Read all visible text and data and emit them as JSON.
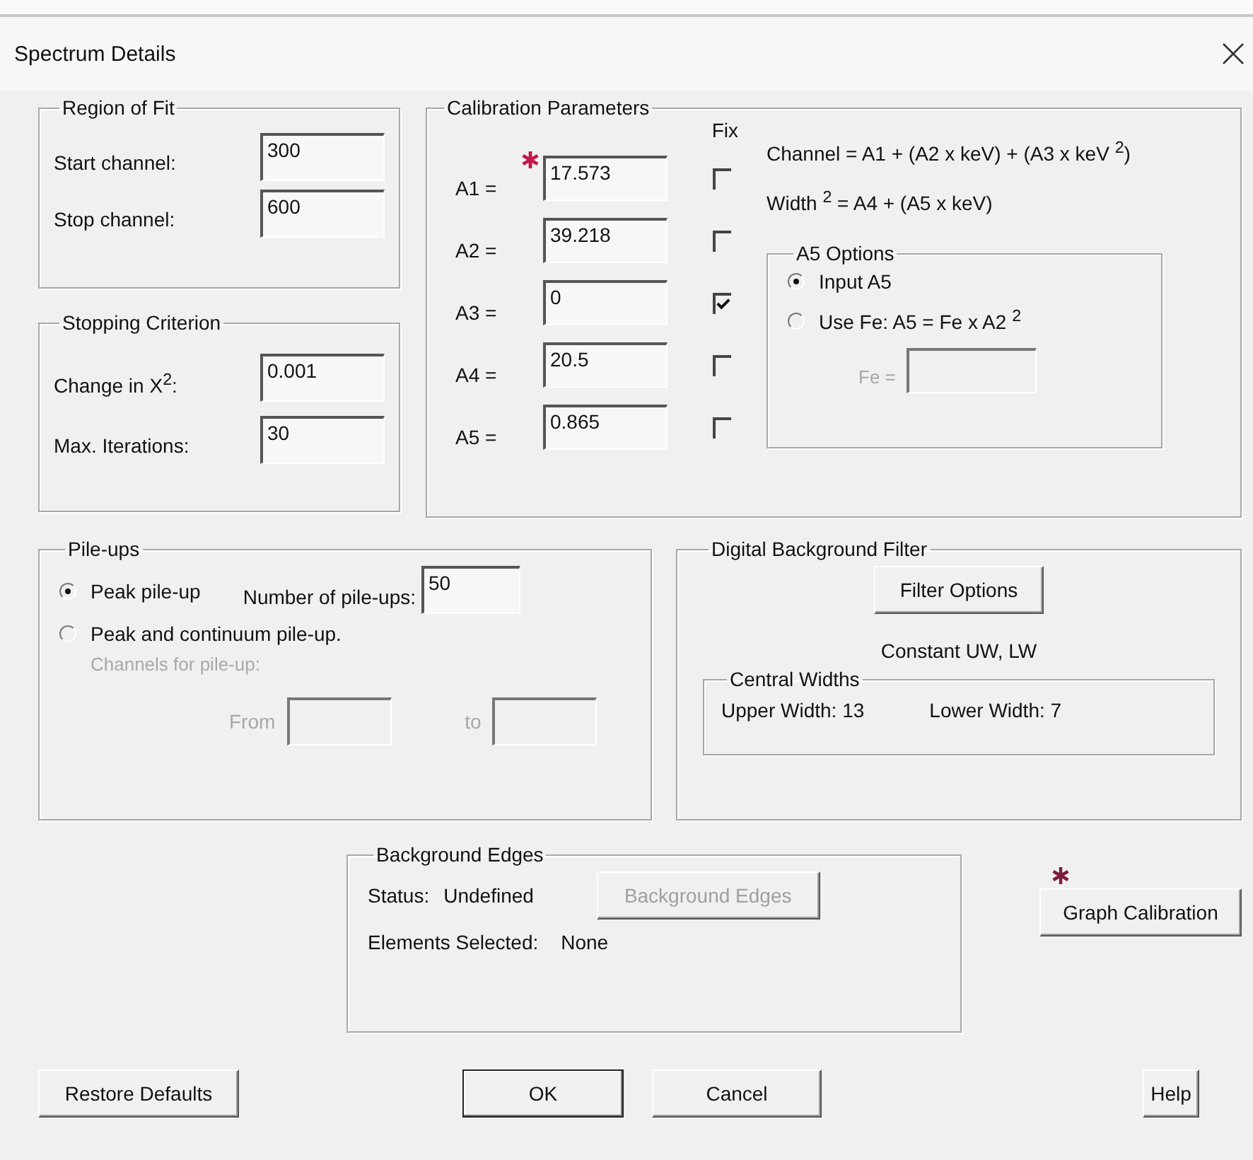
{
  "window": {
    "title": "Spectrum Details"
  },
  "region_of_fit": {
    "title": "Region of Fit",
    "fields": [
      {
        "label": "Start channel:",
        "value": "300"
      },
      {
        "label": "Stop channel:",
        "value": "600"
      }
    ]
  },
  "stopping_criterion": {
    "title": "Stopping Criterion",
    "fields": [
      {
        "label": "Change in X$^{2}$:",
        "value": "0.001"
      },
      {
        "label": "Max. Iterations:",
        "value": "30"
      }
    ]
  },
  "calibration": {
    "title": "Calibration Parameters",
    "fix_header": "Fix",
    "params": [
      {
        "label": "A1 =",
        "value": "17.573",
        "fixed": false,
        "marked": true
      },
      {
        "label": "A2 =",
        "value": "39.218",
        "fixed": false,
        "marked": false
      },
      {
        "label": "A3 =",
        "value": "0",
        "fixed": true,
        "marked": false
      },
      {
        "label": "A4 =",
        "value": "20.5",
        "fixed": false,
        "marked": false
      },
      {
        "label": "A5 =",
        "value": "0.865",
        "fixed": false,
        "marked": false
      }
    ],
    "equations": [
      "Channel = A1 + (A2 x keV) + (A3 x keV $^{2}$)",
      "Width $^{2}$ = A4 + (A5 x keV)"
    ],
    "a5_options": {
      "title": "A5 Options",
      "options": [
        {
          "label": "Input A5",
          "selected": true
        },
        {
          "label": "Use Fe: A5 = Fe x A2 $^{2}$",
          "selected": false
        }
      ],
      "fe_field": {
        "label": "Fe =",
        "disabled": true
      }
    }
  },
  "pileups": {
    "title": "Pile-ups",
    "modes": [
      {
        "label": "Peak pile-up",
        "selected": true
      },
      {
        "label": "Peak and continuum pile-up.",
        "selected": false
      }
    ],
    "count_label": "Number of pile-ups:",
    "count_value": "50",
    "channels": {
      "label": "Channels for pile-up:",
      "from_label": "From",
      "to_label": "to",
      "disabled": true
    }
  },
  "background_filter": {
    "title": "Digital Background Filter",
    "button": "Filter Options",
    "mode": "Constant UW, LW",
    "central_widths": {
      "title": "Central Widths",
      "upper": "Upper Width: 13",
      "lower": "Lower Width: 7"
    }
  },
  "background_edges": {
    "title": "Background Edges",
    "status_label": "Status:",
    "status": "Undefined",
    "button": {
      "label": "Background Edges",
      "disabled": true
    },
    "elements_label": "Elements Selected:",
    "elements": "None"
  },
  "graph_calibration": {
    "label": "Graph Calibration",
    "marked": true
  },
  "buttons": [
    {
      "label": "Restore Defaults",
      "default": false
    },
    {
      "label": "OK",
      "default": true
    },
    {
      "label": "Cancel",
      "default": false
    },
    {
      "label": "Help",
      "default": false
    }
  ]
}
